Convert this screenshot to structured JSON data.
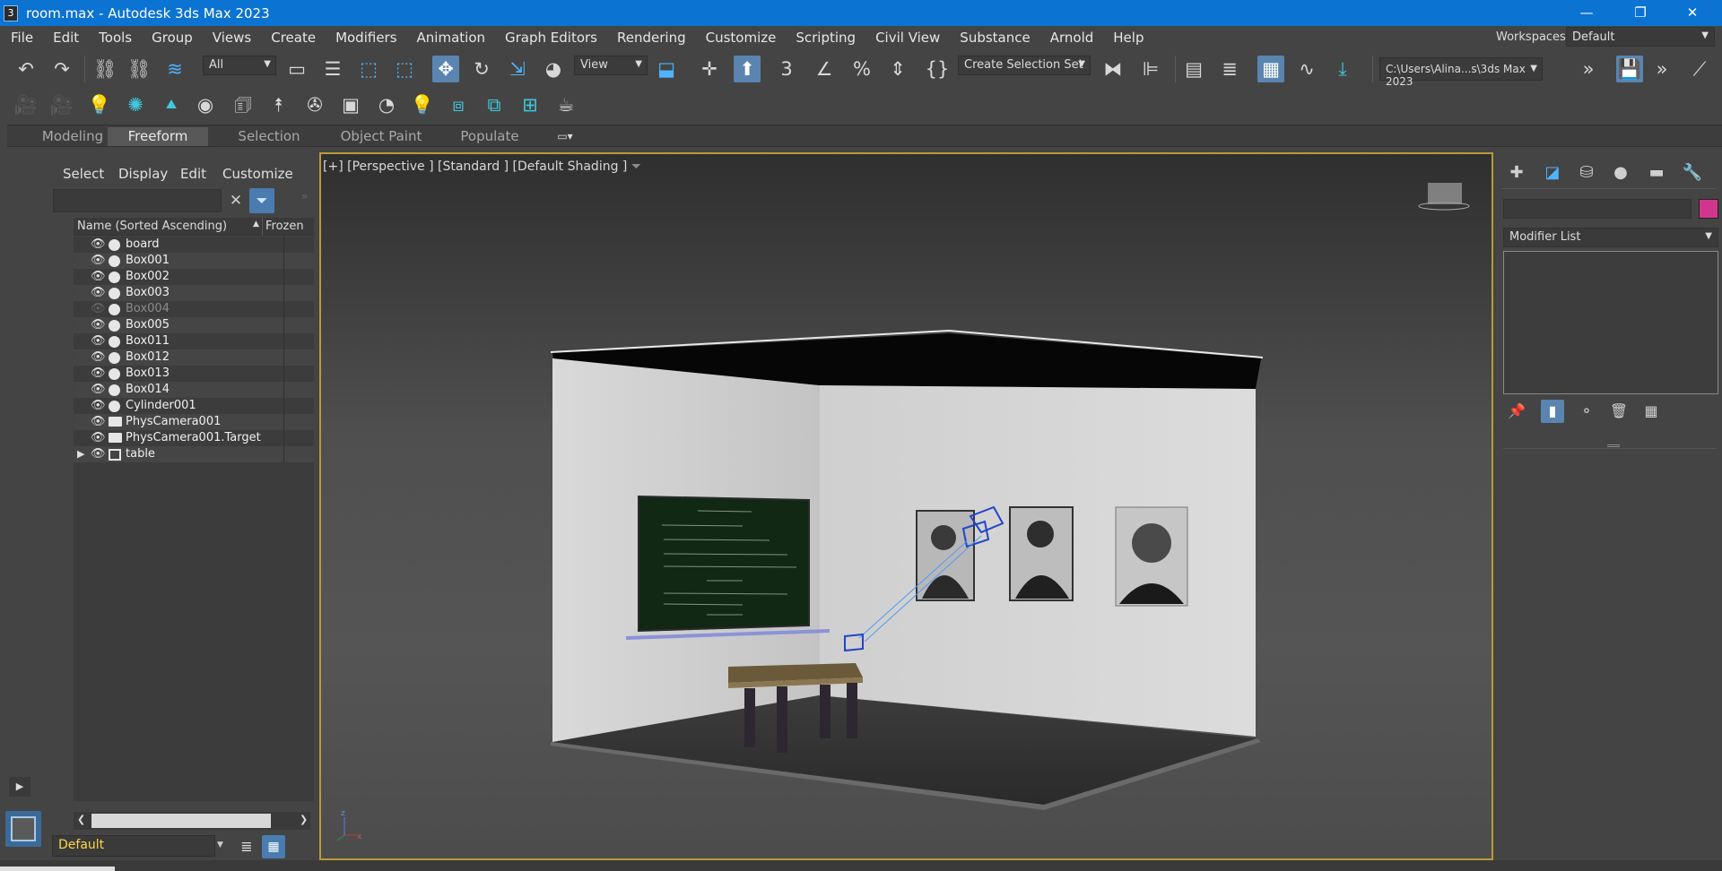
{
  "window": {
    "title": "room.max - Autodesk 3ds Max 2023",
    "app_icon": "3",
    "controls": {
      "minimize": "—",
      "restore": "❐",
      "close": "✕"
    }
  },
  "menu": [
    "File",
    "Edit",
    "Tools",
    "Group",
    "Views",
    "Create",
    "Modifiers",
    "Animation",
    "Graph Editors",
    "Rendering",
    "Customize",
    "Scripting",
    "Civil View",
    "Substance",
    "Arnold",
    "Help"
  ],
  "workspaces": {
    "label": "Workspaces:",
    "value": "Default"
  },
  "toolbar": {
    "selection_filter": "All",
    "ref_coord": "View",
    "selection_set": "Create Selection Set",
    "project_path": "C:\\Users\\Alina...s\\3ds Max 2023"
  },
  "ribbon_tabs": [
    "Modeling",
    "Freeform",
    "Selection",
    "Object Paint",
    "Populate"
  ],
  "ribbon_active": "Freeform",
  "explorer": {
    "menu": [
      "Select",
      "Display",
      "Edit",
      "Customize"
    ],
    "columns": {
      "name": "Name (Sorted Ascending)",
      "frozen": "Frozen"
    },
    "rows": [
      {
        "name": "board",
        "icon": "geometry"
      },
      {
        "name": "Box001",
        "icon": "geometry"
      },
      {
        "name": "Box002",
        "icon": "geometry"
      },
      {
        "name": "Box003",
        "icon": "geometry"
      },
      {
        "name": "Box004",
        "icon": "geometry",
        "hidden": true
      },
      {
        "name": "Box005",
        "icon": "geometry"
      },
      {
        "name": "Box011",
        "icon": "geometry"
      },
      {
        "name": "Box012",
        "icon": "geometry"
      },
      {
        "name": "Box013",
        "icon": "geometry"
      },
      {
        "name": "Box014",
        "icon": "geometry"
      },
      {
        "name": "Cylinder001",
        "icon": "geometry"
      },
      {
        "name": "PhysCamera001",
        "icon": "camera"
      },
      {
        "name": "PhysCamera001.Target",
        "icon": "camera"
      },
      {
        "name": "table",
        "icon": "group"
      }
    ],
    "layer": "Default"
  },
  "viewport": {
    "label": "[+] [Perspective ] [Standard ] [Default Shading ]"
  },
  "command_panel": {
    "modifier_list": "Modifier List",
    "object_color": "#d0378c"
  },
  "colors": {
    "titlebar": "#0b73d1",
    "viewport_border": "#b89a3a",
    "accent": "#4fb3ff"
  }
}
